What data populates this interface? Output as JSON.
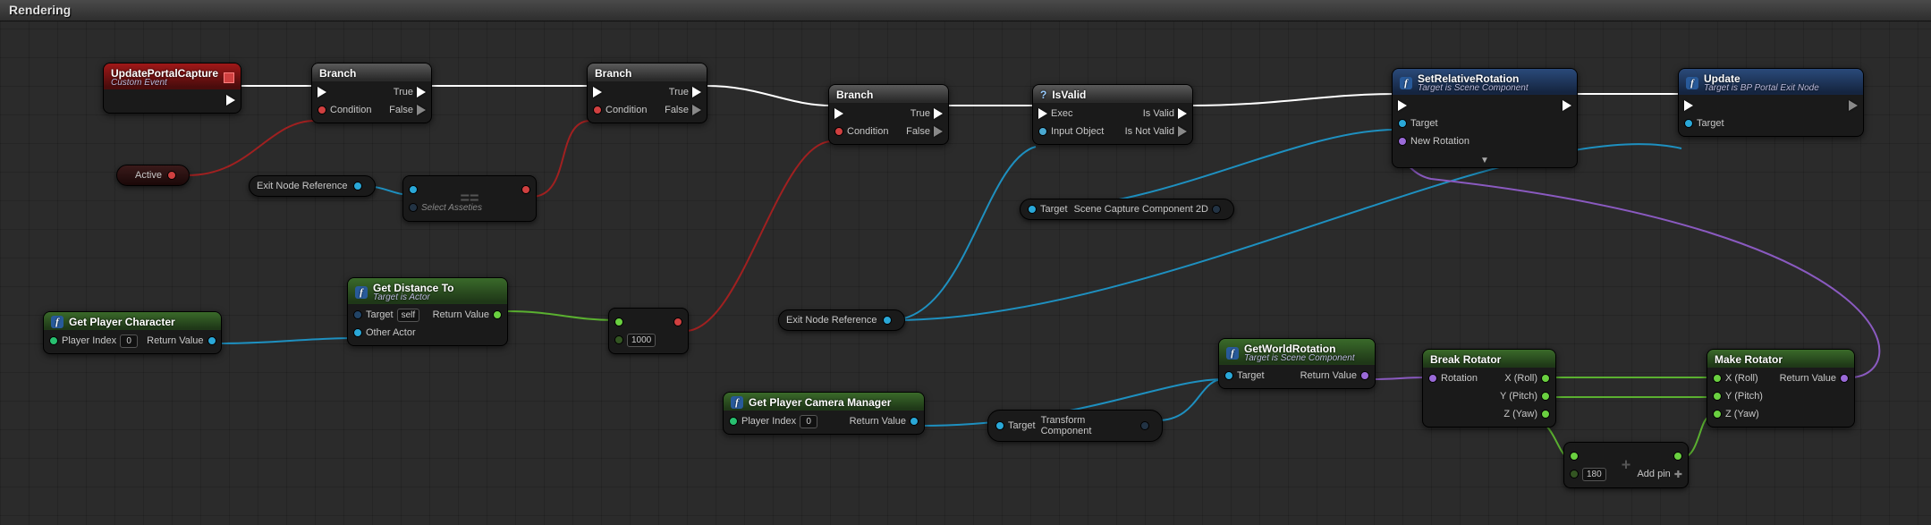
{
  "header": {
    "title": "Rendering"
  },
  "nodes": {
    "updatePortalCapture": {
      "title": "UpdatePortalCapture",
      "subtitle": "Custom Event"
    },
    "branch1": {
      "title": "Branch",
      "condition": "Condition",
      "true": "True",
      "false": "False"
    },
    "branch2": {
      "title": "Branch",
      "condition": "Condition",
      "true": "True",
      "false": "False"
    },
    "branch3": {
      "title": "Branch",
      "condition": "Condition",
      "true": "True",
      "false": "False"
    },
    "isValid": {
      "title": "IsValid",
      "exec": "Exec",
      "input": "Input Object",
      "valid": "Is Valid",
      "notvalid": "Is Not Valid"
    },
    "setRelRot": {
      "title": "SetRelativeRotation",
      "subtitle": "Target is Scene Component",
      "target": "Target",
      "newrot": "New Rotation"
    },
    "update": {
      "title": "Update",
      "subtitle": "Target is BP Portal Exit Node",
      "target": "Target"
    },
    "getDist": {
      "title": "Get Distance To",
      "subtitle": "Target is Actor",
      "target": "Target",
      "self": "self",
      "other": "Other Actor",
      "ret": "Return Value"
    },
    "getPlayerChar": {
      "title": "Get Player Character",
      "pidx": "Player Index",
      "pval": "0",
      "ret": "Return Value"
    },
    "getPlayerCam": {
      "title": "Get Player Camera Manager",
      "pidx": "Player Index",
      "pval": "0",
      "ret": "Return Value"
    },
    "getWorldRot": {
      "title": "GetWorldRotation",
      "subtitle": "Target is Scene Component",
      "target": "Target",
      "ret": "Return Value"
    },
    "breakRot": {
      "title": "Break Rotator",
      "rotation": "Rotation",
      "x": "X (Roll)",
      "y": "Y (Pitch)",
      "z": "Z (Yaw)"
    },
    "makeRot": {
      "title": "Make Rotator",
      "x": "X (Roll)",
      "y": "Y (Pitch)",
      "z": "Z (Yaw)",
      "ret": "Return Value"
    }
  },
  "pills": {
    "active": "Active",
    "exitNode1": "Exit Node Reference",
    "exitNode2": "Exit Node Reference",
    "sceneCap": {
      "target": "Target",
      "label": "Scene Capture Component 2D"
    },
    "transform": {
      "target": "Target",
      "label": "Transform Component"
    }
  },
  "compact": {
    "selectAsset": {
      "label": "Select Asseties",
      "op": "=="
    },
    "compare": {
      "value": "1000",
      "op": "<="
    },
    "add": {
      "value": "180",
      "addpin": "Add pin",
      "op": "+"
    }
  }
}
